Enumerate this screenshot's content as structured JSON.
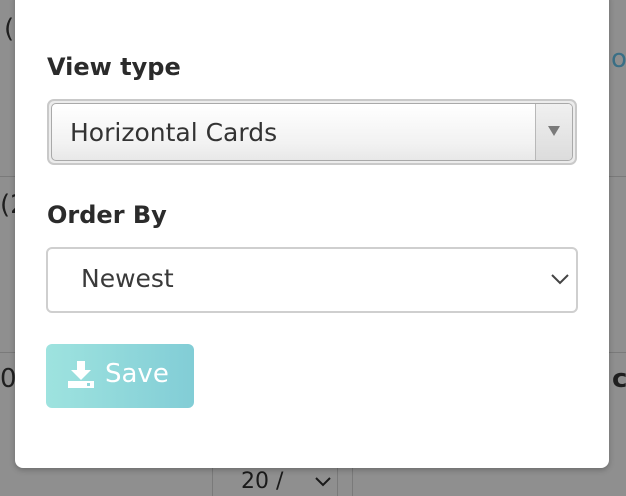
{
  "background": {
    "fragments": [
      "(",
      "(2",
      "0"
    ],
    "link_fragment": "o",
    "edge_fragment": "c",
    "pager_value": "20 /"
  },
  "modal": {
    "view_type": {
      "label": "View type",
      "selected": "Horizontal Cards"
    },
    "order_by": {
      "label": "Order By",
      "selected": "Newest"
    },
    "save_button": {
      "label": "Save",
      "icon": "download-icon",
      "color_start": "#9ee3df",
      "color_end": "#82cdd6"
    }
  }
}
